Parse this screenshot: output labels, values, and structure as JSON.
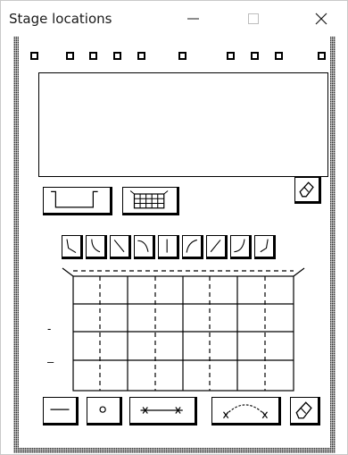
{
  "window": {
    "title": "Stage locations",
    "controls": {
      "minimize_icon": "minimize-icon",
      "maximize_icon": "maximize-icon",
      "close_icon": "close-icon"
    }
  },
  "panel": {
    "left_marks": [
      "-",
      "–"
    ]
  },
  "colors": {
    "background": "#ffffff",
    "ink": "#000000",
    "frame_pattern": "#2f2f2f"
  }
}
